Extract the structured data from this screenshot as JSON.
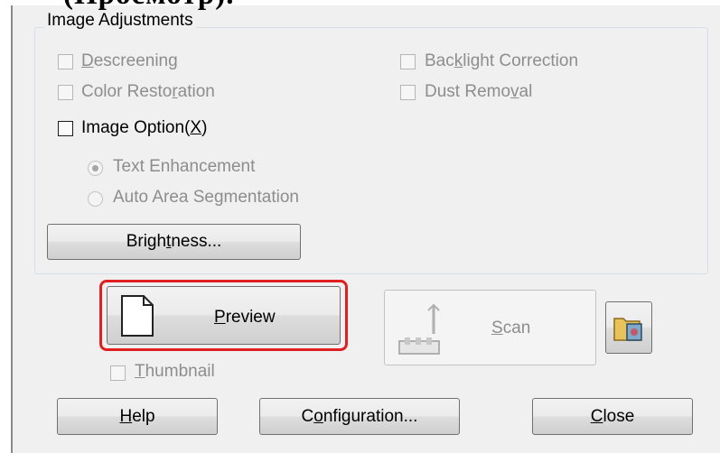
{
  "caption": {
    "text": "(Просмотр)."
  },
  "group": {
    "title": "Image Adjustments"
  },
  "options": {
    "descreening": "Descreening",
    "backlight": "Backlight Correction",
    "color_restoration": "Color Restoration",
    "dust_removal": "Dust Removal",
    "image_option": "Image Option(X)",
    "text_enhancement": "Text Enhancement",
    "auto_area": "Auto Area Segmentation"
  },
  "buttons": {
    "brightness": "Brightness...",
    "preview": "Preview",
    "scan": "Scan",
    "help": "Help",
    "configuration": "Configuration...",
    "close": "Close"
  },
  "thumbnail": {
    "label": "Thumbnail"
  },
  "icons": [
    "document-icon",
    "scan-icon",
    "folder-photo-icon"
  ],
  "colors": {
    "highlight": "#e02020",
    "dialog_bg": "#f0f0f0",
    "disabled_text": "#8d8d8d"
  }
}
